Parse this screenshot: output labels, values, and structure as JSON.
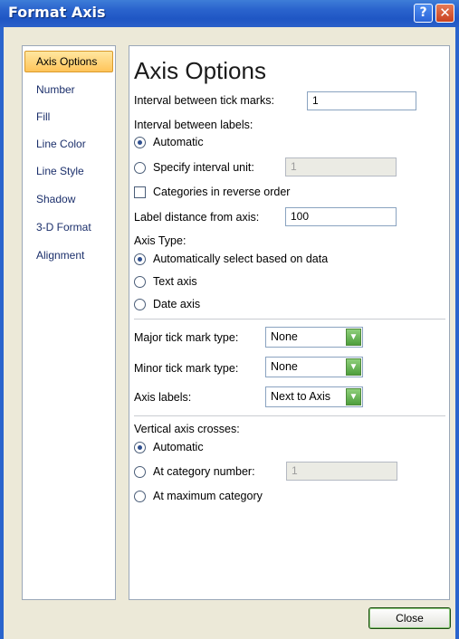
{
  "window": {
    "title": "Format Axis",
    "help_glyph": "?",
    "close_glyph": "✕"
  },
  "nav": {
    "items": [
      {
        "label": "Axis Options",
        "selected": true
      },
      {
        "label": "Number"
      },
      {
        "label": "Fill"
      },
      {
        "label": "Line Color"
      },
      {
        "label": "Line Style"
      },
      {
        "label": "Shadow"
      },
      {
        "label": "3-D Format"
      },
      {
        "label": "Alignment"
      }
    ]
  },
  "main": {
    "heading": "Axis Options",
    "tick_interval_label": "Interval between tick marks:",
    "tick_interval_value": "1",
    "label_interval_label": "Interval between labels:",
    "radio_automatic": "Automatic",
    "radio_specify": "Specify interval unit:",
    "specify_value": "1",
    "reverse_order": "Categories in reverse order",
    "label_distance_label": "Label distance from axis:",
    "label_distance_value": "100",
    "axis_type_label": "Axis Type:",
    "auto_select": "Automatically select based on data",
    "text_axis": "Text axis",
    "date_axis": "Date axis",
    "major_tick_label": "Major tick mark type:",
    "major_tick_value": "None",
    "minor_tick_label": "Minor tick mark type:",
    "minor_tick_value": "None",
    "axis_labels_label": "Axis labels:",
    "axis_labels_value": "Next to Axis",
    "vertical_crosses_label": "Vertical axis crosses:",
    "cross_automatic": "Automatic",
    "cross_category": "At category number:",
    "cross_category_value": "1",
    "cross_max": "At maximum category"
  },
  "footer": {
    "close_label": "Close"
  }
}
